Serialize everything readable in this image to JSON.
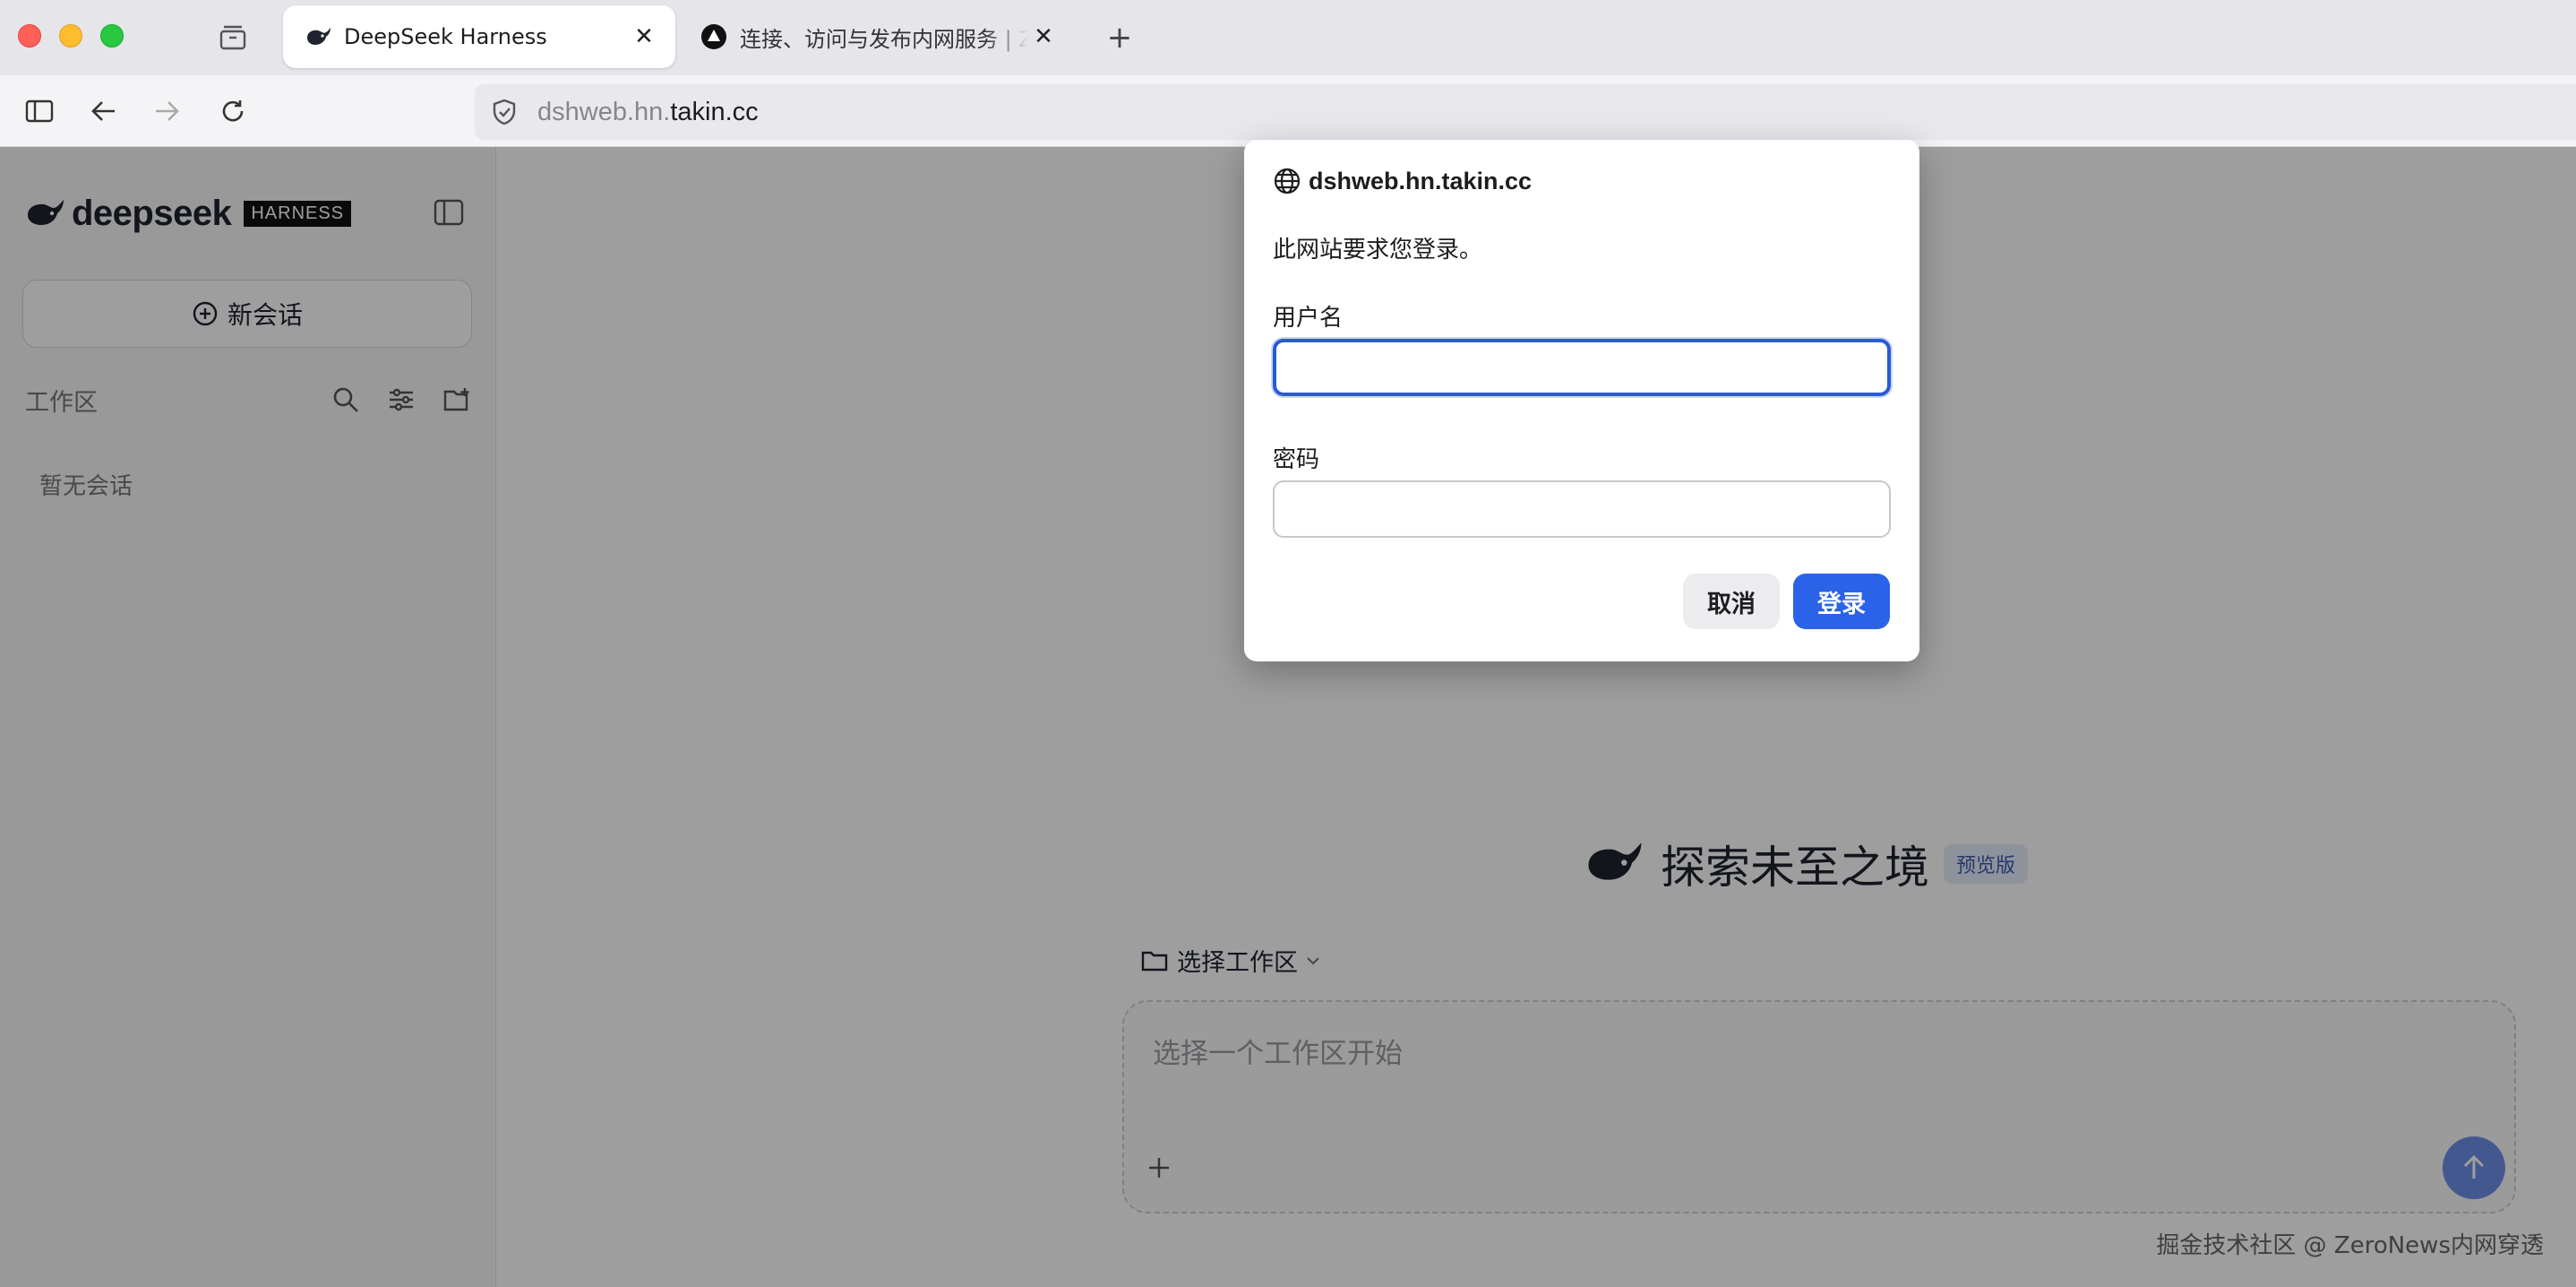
{
  "browser": {
    "tabs": [
      {
        "title": "DeepSeek Harness",
        "active": true
      },
      {
        "title": "连接、访问与发布内网服务 | ZeroNews",
        "active": false
      }
    ],
    "url_prefix": "dshweb.hn.",
    "url_domain": "takin.cc"
  },
  "sidebar": {
    "brand": "deepseek",
    "brand_tag": "HARNESS",
    "new_chat_label": "新会话",
    "workspace_label": "工作区",
    "empty_text": "暂无会话"
  },
  "main": {
    "hero_title": "探索未至之境",
    "hero_badge": "预览版",
    "workspace_select": "选择工作区",
    "composer_placeholder": "选择一个工作区开始",
    "footer_note": "掘金技术社区 @ ZeroNews内网穿透"
  },
  "dialog": {
    "host": "dshweb.hn.takin.cc",
    "message": "此网站要求您登录。",
    "username_label": "用户名",
    "username_value": "",
    "password_label": "密码",
    "password_value": "",
    "cancel_label": "取消",
    "login_label": "登录"
  },
  "colors": {
    "accent": "#2a63e8",
    "send_button": "#6e8ee8",
    "badge_bg": "#e6ecfb"
  }
}
